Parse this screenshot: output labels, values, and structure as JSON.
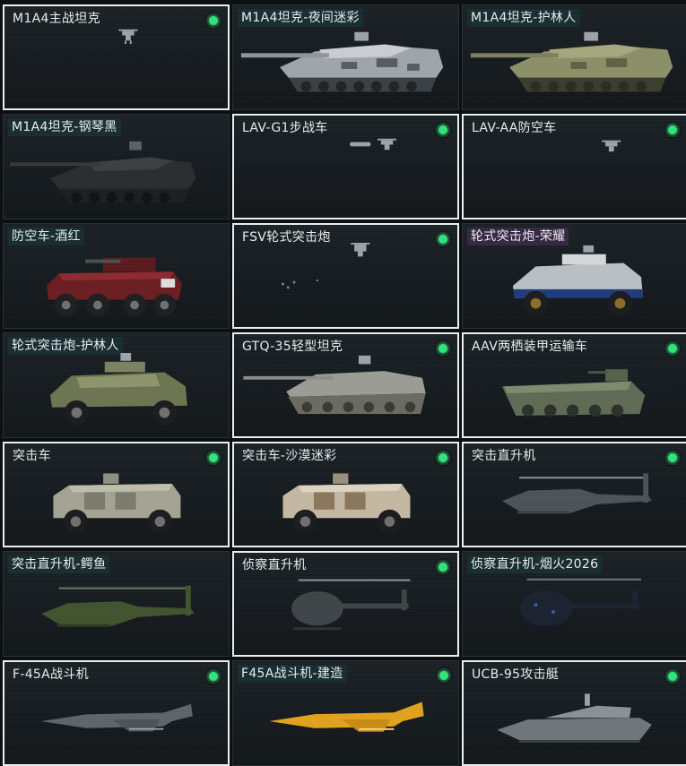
{
  "colors": {
    "accent_green": "#2ee37a",
    "card_bg": "#171c20",
    "selected_border": "#e9eef0",
    "label_bg": "#183032"
  },
  "vehicles": [
    {
      "name": "M1A4主战坦克",
      "selected": true,
      "badge": true,
      "icon": "drone-icon"
    },
    {
      "name": "M1A4坦克-夜间迷彩",
      "selected": false,
      "badge": false,
      "icon": "tank-night-camo-icon"
    },
    {
      "name": "M1A4坦克-护林人",
      "selected": false,
      "badge": false,
      "icon": "tank-forest-camo-icon"
    },
    {
      "name": "M1A4坦克-钢琴黑",
      "selected": false,
      "badge": false,
      "icon": "tank-black-icon"
    },
    {
      "name": "LAV-G1步战车",
      "selected": true,
      "badge": true,
      "icon": "drone-icon"
    },
    {
      "name": "LAV-AA防空车",
      "selected": true,
      "badge": true,
      "icon": "drone-icon"
    },
    {
      "name": "防空车-酒红",
      "selected": false,
      "badge": false,
      "icon": "aa-vehicle-red-icon"
    },
    {
      "name": "FSV轮式突击炮",
      "selected": true,
      "badge": true,
      "icon": "drone-icon"
    },
    {
      "name": "轮式突击炮-荣耀",
      "selected": false,
      "badge": false,
      "icon": "wheeled-gun-glory-icon"
    },
    {
      "name": "轮式突击炮-护林人",
      "selected": false,
      "badge": false,
      "icon": "wheeled-gun-forest-icon"
    },
    {
      "name": "GTQ-35轻型坦克",
      "selected": true,
      "badge": true,
      "icon": "light-tank-icon"
    },
    {
      "name": "AAV两栖装甲运输车",
      "selected": true,
      "badge": true,
      "icon": "amphibious-apc-icon"
    },
    {
      "name": "突击车",
      "selected": true,
      "badge": true,
      "icon": "assault-vehicle-icon"
    },
    {
      "name": "突击车-沙漠迷彩",
      "selected": true,
      "badge": true,
      "icon": "assault-vehicle-desert-icon"
    },
    {
      "name": "突击直升机",
      "selected": true,
      "badge": true,
      "icon": "attack-helicopter-icon"
    },
    {
      "name": "突击直升机-鳄鱼",
      "selected": false,
      "badge": false,
      "icon": "attack-helicopter-croc-icon"
    },
    {
      "name": "侦察直升机",
      "selected": true,
      "badge": true,
      "icon": "scout-helicopter-icon"
    },
    {
      "name": "侦察直升机-烟火2026",
      "selected": false,
      "badge": false,
      "icon": "scout-helicopter-fireworks-icon"
    },
    {
      "name": "F-45A战斗机",
      "selected": true,
      "badge": true,
      "icon": "fighter-jet-icon"
    },
    {
      "name": "F45A战斗机-建造",
      "selected": false,
      "badge": true,
      "icon": "fighter-jet-yellow-icon"
    },
    {
      "name": "UCB-95攻击艇",
      "selected": true,
      "badge": true,
      "icon": "attack-boat-icon"
    }
  ]
}
